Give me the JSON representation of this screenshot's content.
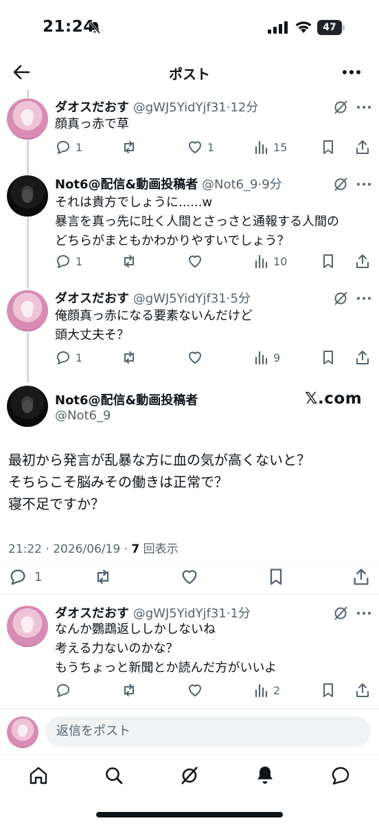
{
  "status_bar": {
    "time": "21:24",
    "battery": "47"
  },
  "header": {
    "title": "ポスト"
  },
  "posts": [
    {
      "name": "ダオスだおす",
      "handle": "@gWJ5YidYjf31",
      "time": "12分",
      "text": "顔真っ赤で草",
      "replies": "1",
      "reposts": "",
      "likes": "1",
      "views": "15"
    },
    {
      "name": "Not6@配信&動画投稿者",
      "handle": "@Not6_9",
      "time": "9分",
      "text": "それは貴方でしょうに......w\n暴言を真っ先に吐く人間とさっさと通報する人間の\nどちらがまともかわかりやすいでしょう？",
      "replies": "1",
      "reposts": "",
      "likes": "",
      "views": "10"
    },
    {
      "name": "ダオスだおす",
      "handle": "@gWJ5YidYjf31",
      "time": "5分",
      "text": "俺顔真っ赤になる要素ないんだけど\n頭大丈夫そ？",
      "replies": "1",
      "reposts": "",
      "likes": "",
      "views": "9"
    }
  ],
  "main_post": {
    "name": "Not6@配信&動画投稿者",
    "handle": "@Not6_9",
    "watermark": "𝕏.com",
    "text": "最初から発言が乱暴な方に血の気が高くないと？\nそちらこそ脳みその働きは正常で？\n寝不足ですか？",
    "timestamp": "21:22 · 2026/06/19 · ",
    "view_count": "7",
    "view_label": " 回表示",
    "replies": "1"
  },
  "reply_post": {
    "name": "ダオスだおす",
    "handle": "@gWJ5YidYjf31",
    "time": "1分",
    "text": "なんか鸚鵡返ししかしないね\n考える力ないのかな？\nもうちょっと新聞とか読んだ方がいいよ",
    "replies": "",
    "reposts": "",
    "likes": "",
    "views": "2"
  },
  "reply_bar": {
    "placeholder": "返信をポスト"
  },
  "tabs": [
    "home-icon",
    "search-icon",
    "grok-icon",
    "notifications-icon",
    "messages-icon"
  ],
  "colors": {
    "text": "#0f1419",
    "muted": "#536471",
    "line": "#cfd9de",
    "input_bg": "#eff3f4"
  }
}
